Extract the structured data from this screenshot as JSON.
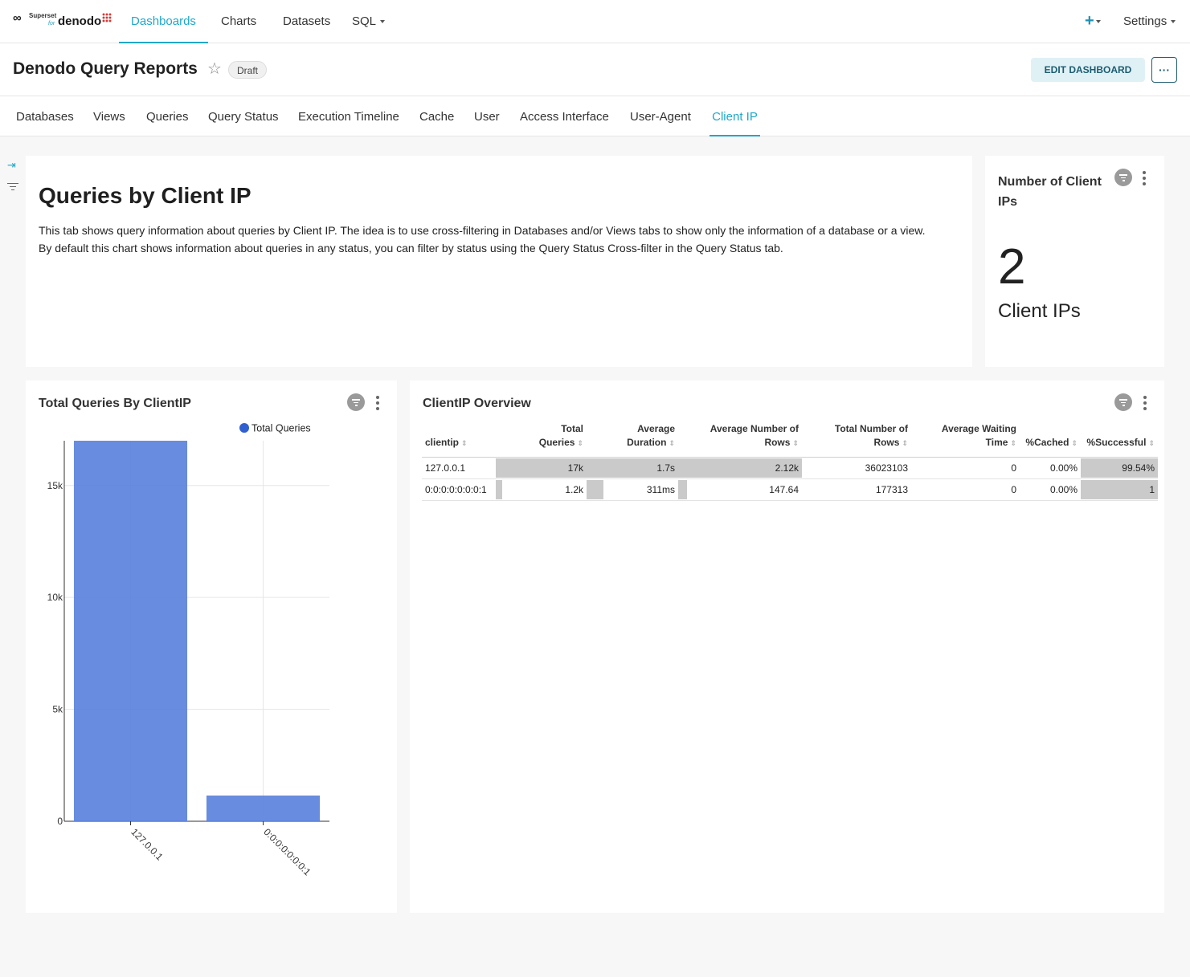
{
  "nav": {
    "brand": {
      "line1": "Superset",
      "line2": "for",
      "line3": "denodo"
    },
    "items": [
      {
        "label": "Dashboards",
        "active": true
      },
      {
        "label": "Charts"
      },
      {
        "label": "Datasets"
      },
      {
        "label": "SQL"
      }
    ],
    "plus": "+",
    "settings": "Settings"
  },
  "header": {
    "title": "Denodo Query Reports",
    "badge": "Draft",
    "edit_label": "EDIT DASHBOARD",
    "more_label": "···"
  },
  "tabs": [
    {
      "label": "Databases"
    },
    {
      "label": "Views"
    },
    {
      "label": "Queries"
    },
    {
      "label": "Query Status"
    },
    {
      "label": "Execution Timeline"
    },
    {
      "label": "Cache"
    },
    {
      "label": "User"
    },
    {
      "label": "Access Interface"
    },
    {
      "label": "User-Agent"
    },
    {
      "label": "Client IP",
      "active": true
    }
  ],
  "markdown": {
    "heading": "Queries by Client IP",
    "p1": "This tab shows query information about queries by Client IP. The idea is to use cross-filtering in Databases and/or Views tabs to show only the information of a database or a view.",
    "p2": "By default this chart shows information about queries in any status, you can filter by status using the Query Status Cross-filter in the Query Status tab."
  },
  "bignumber": {
    "title": "Number of Client IPs",
    "value": "2",
    "subtitle": "Client IPs"
  },
  "chart_data": {
    "type": "bar",
    "title": "Total Queries By ClientIP",
    "categories": [
      "127.0.0.1",
      "0:0:0:0:0:0:0:1"
    ],
    "series": [
      {
        "name": "Total Queries",
        "values": [
          17000,
          1150
        ],
        "color": "#5b82dc"
      }
    ],
    "ylim": [
      0,
      17000
    ],
    "yticks": [
      0,
      5000,
      10000,
      15000
    ],
    "ytick_labels": [
      "0",
      "5k",
      "10k",
      "15k"
    ],
    "legend": "top-right",
    "grid": true
  },
  "table": {
    "title": "ClientIP Overview",
    "columns": [
      {
        "line1": "",
        "line2": "clientip"
      },
      {
        "line1": "Total",
        "line2": "Queries"
      },
      {
        "line1": "Average",
        "line2": "Duration"
      },
      {
        "line1": "Average Number of",
        "line2": "Rows"
      },
      {
        "line1": "Total Number of",
        "line2": "Rows"
      },
      {
        "line1": "Average Waiting",
        "line2": "Time"
      },
      {
        "line1": "",
        "line2": "%Cached"
      },
      {
        "line1": "",
        "line2": "%Successful"
      }
    ],
    "rows": [
      {
        "cells": [
          "127.0.0.1",
          "17k",
          "1.7s",
          "2.12k",
          "36023103",
          "0",
          "0.00%",
          "99.54%"
        ],
        "fill": [
          null,
          1,
          1,
          1,
          null,
          null,
          null,
          1
        ]
      },
      {
        "cells": [
          "0:0:0:0:0:0:0:1",
          "1.2k",
          "311ms",
          "147.64",
          "177313",
          "0",
          "0.00%",
          "1"
        ],
        "fill": [
          null,
          0.07,
          0.18,
          0.07,
          null,
          null,
          null,
          1
        ]
      }
    ]
  }
}
